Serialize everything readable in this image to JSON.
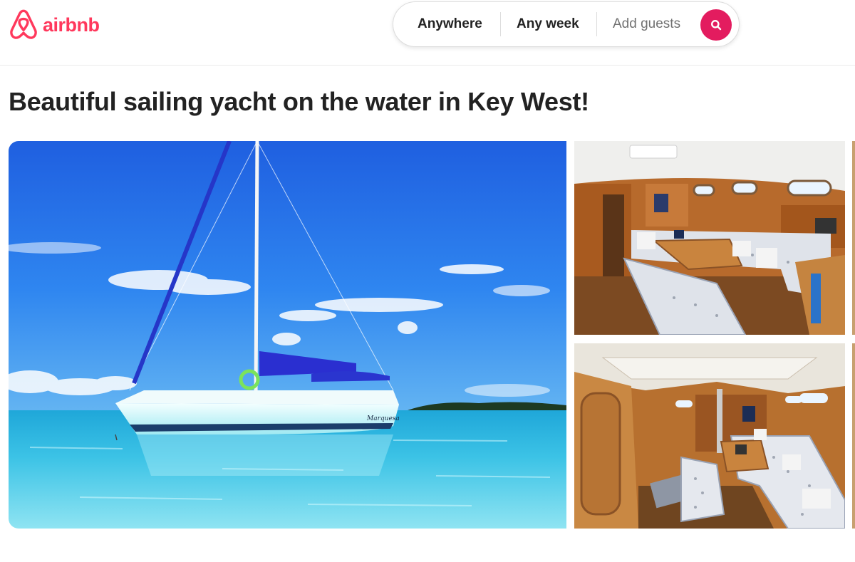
{
  "brand": {
    "name": "airbnb",
    "color": "#FF385C",
    "icon": "airbnb-logo-icon"
  },
  "search": {
    "location": "Anywhere",
    "dates": "Any week",
    "guests_placeholder": "Add guests",
    "button_icon": "search-icon",
    "button_color": "#E31C5F"
  },
  "listing": {
    "title": "Beautiful sailing yacht on the water in Key West!",
    "photos": [
      {
        "name": "sailing-yacht-exterior-photo",
        "alt": "Sailing yacht on turquoise water"
      },
      {
        "name": "yacht-cabin-salon-photo",
        "alt": "Yacht cabin salon interior"
      },
      {
        "name": "yacht-cabin-interior-photo",
        "alt": "Yacht cabin interior wide view"
      }
    ],
    "boat_name": "Marquesa"
  }
}
